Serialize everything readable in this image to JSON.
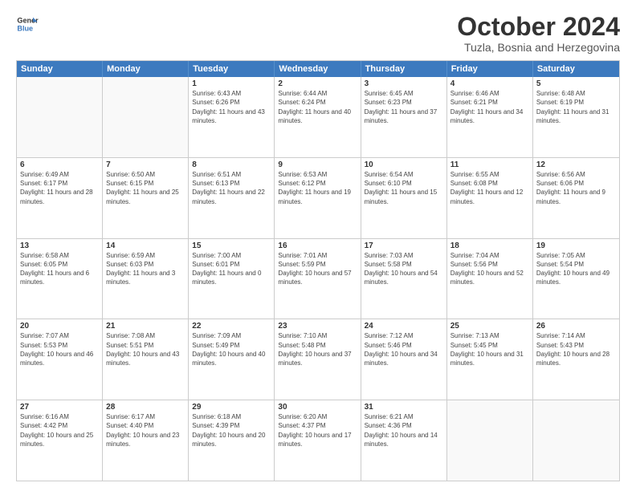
{
  "header": {
    "logo_line1": "General",
    "logo_line2": "Blue",
    "month": "October 2024",
    "location": "Tuzla, Bosnia and Herzegovina"
  },
  "weekdays": [
    "Sunday",
    "Monday",
    "Tuesday",
    "Wednesday",
    "Thursday",
    "Friday",
    "Saturday"
  ],
  "rows": [
    [
      {
        "day": "",
        "sunrise": "",
        "sunset": "",
        "daylight": ""
      },
      {
        "day": "",
        "sunrise": "",
        "sunset": "",
        "daylight": ""
      },
      {
        "day": "1",
        "sunrise": "Sunrise: 6:43 AM",
        "sunset": "Sunset: 6:26 PM",
        "daylight": "Daylight: 11 hours and 43 minutes."
      },
      {
        "day": "2",
        "sunrise": "Sunrise: 6:44 AM",
        "sunset": "Sunset: 6:24 PM",
        "daylight": "Daylight: 11 hours and 40 minutes."
      },
      {
        "day": "3",
        "sunrise": "Sunrise: 6:45 AM",
        "sunset": "Sunset: 6:23 PM",
        "daylight": "Daylight: 11 hours and 37 minutes."
      },
      {
        "day": "4",
        "sunrise": "Sunrise: 6:46 AM",
        "sunset": "Sunset: 6:21 PM",
        "daylight": "Daylight: 11 hours and 34 minutes."
      },
      {
        "day": "5",
        "sunrise": "Sunrise: 6:48 AM",
        "sunset": "Sunset: 6:19 PM",
        "daylight": "Daylight: 11 hours and 31 minutes."
      }
    ],
    [
      {
        "day": "6",
        "sunrise": "Sunrise: 6:49 AM",
        "sunset": "Sunset: 6:17 PM",
        "daylight": "Daylight: 11 hours and 28 minutes."
      },
      {
        "day": "7",
        "sunrise": "Sunrise: 6:50 AM",
        "sunset": "Sunset: 6:15 PM",
        "daylight": "Daylight: 11 hours and 25 minutes."
      },
      {
        "day": "8",
        "sunrise": "Sunrise: 6:51 AM",
        "sunset": "Sunset: 6:13 PM",
        "daylight": "Daylight: 11 hours and 22 minutes."
      },
      {
        "day": "9",
        "sunrise": "Sunrise: 6:53 AM",
        "sunset": "Sunset: 6:12 PM",
        "daylight": "Daylight: 11 hours and 19 minutes."
      },
      {
        "day": "10",
        "sunrise": "Sunrise: 6:54 AM",
        "sunset": "Sunset: 6:10 PM",
        "daylight": "Daylight: 11 hours and 15 minutes."
      },
      {
        "day": "11",
        "sunrise": "Sunrise: 6:55 AM",
        "sunset": "Sunset: 6:08 PM",
        "daylight": "Daylight: 11 hours and 12 minutes."
      },
      {
        "day": "12",
        "sunrise": "Sunrise: 6:56 AM",
        "sunset": "Sunset: 6:06 PM",
        "daylight": "Daylight: 11 hours and 9 minutes."
      }
    ],
    [
      {
        "day": "13",
        "sunrise": "Sunrise: 6:58 AM",
        "sunset": "Sunset: 6:05 PM",
        "daylight": "Daylight: 11 hours and 6 minutes."
      },
      {
        "day": "14",
        "sunrise": "Sunrise: 6:59 AM",
        "sunset": "Sunset: 6:03 PM",
        "daylight": "Daylight: 11 hours and 3 minutes."
      },
      {
        "day": "15",
        "sunrise": "Sunrise: 7:00 AM",
        "sunset": "Sunset: 6:01 PM",
        "daylight": "Daylight: 11 hours and 0 minutes."
      },
      {
        "day": "16",
        "sunrise": "Sunrise: 7:01 AM",
        "sunset": "Sunset: 5:59 PM",
        "daylight": "Daylight: 10 hours and 57 minutes."
      },
      {
        "day": "17",
        "sunrise": "Sunrise: 7:03 AM",
        "sunset": "Sunset: 5:58 PM",
        "daylight": "Daylight: 10 hours and 54 minutes."
      },
      {
        "day": "18",
        "sunrise": "Sunrise: 7:04 AM",
        "sunset": "Sunset: 5:56 PM",
        "daylight": "Daylight: 10 hours and 52 minutes."
      },
      {
        "day": "19",
        "sunrise": "Sunrise: 7:05 AM",
        "sunset": "Sunset: 5:54 PM",
        "daylight": "Daylight: 10 hours and 49 minutes."
      }
    ],
    [
      {
        "day": "20",
        "sunrise": "Sunrise: 7:07 AM",
        "sunset": "Sunset: 5:53 PM",
        "daylight": "Daylight: 10 hours and 46 minutes."
      },
      {
        "day": "21",
        "sunrise": "Sunrise: 7:08 AM",
        "sunset": "Sunset: 5:51 PM",
        "daylight": "Daylight: 10 hours and 43 minutes."
      },
      {
        "day": "22",
        "sunrise": "Sunrise: 7:09 AM",
        "sunset": "Sunset: 5:49 PM",
        "daylight": "Daylight: 10 hours and 40 minutes."
      },
      {
        "day": "23",
        "sunrise": "Sunrise: 7:10 AM",
        "sunset": "Sunset: 5:48 PM",
        "daylight": "Daylight: 10 hours and 37 minutes."
      },
      {
        "day": "24",
        "sunrise": "Sunrise: 7:12 AM",
        "sunset": "Sunset: 5:46 PM",
        "daylight": "Daylight: 10 hours and 34 minutes."
      },
      {
        "day": "25",
        "sunrise": "Sunrise: 7:13 AM",
        "sunset": "Sunset: 5:45 PM",
        "daylight": "Daylight: 10 hours and 31 minutes."
      },
      {
        "day": "26",
        "sunrise": "Sunrise: 7:14 AM",
        "sunset": "Sunset: 5:43 PM",
        "daylight": "Daylight: 10 hours and 28 minutes."
      }
    ],
    [
      {
        "day": "27",
        "sunrise": "Sunrise: 6:16 AM",
        "sunset": "Sunset: 4:42 PM",
        "daylight": "Daylight: 10 hours and 25 minutes."
      },
      {
        "day": "28",
        "sunrise": "Sunrise: 6:17 AM",
        "sunset": "Sunset: 4:40 PM",
        "daylight": "Daylight: 10 hours and 23 minutes."
      },
      {
        "day": "29",
        "sunrise": "Sunrise: 6:18 AM",
        "sunset": "Sunset: 4:39 PM",
        "daylight": "Daylight: 10 hours and 20 minutes."
      },
      {
        "day": "30",
        "sunrise": "Sunrise: 6:20 AM",
        "sunset": "Sunset: 4:37 PM",
        "daylight": "Daylight: 10 hours and 17 minutes."
      },
      {
        "day": "31",
        "sunrise": "Sunrise: 6:21 AM",
        "sunset": "Sunset: 4:36 PM",
        "daylight": "Daylight: 10 hours and 14 minutes."
      },
      {
        "day": "",
        "sunrise": "",
        "sunset": "",
        "daylight": ""
      },
      {
        "day": "",
        "sunrise": "",
        "sunset": "",
        "daylight": ""
      }
    ]
  ]
}
